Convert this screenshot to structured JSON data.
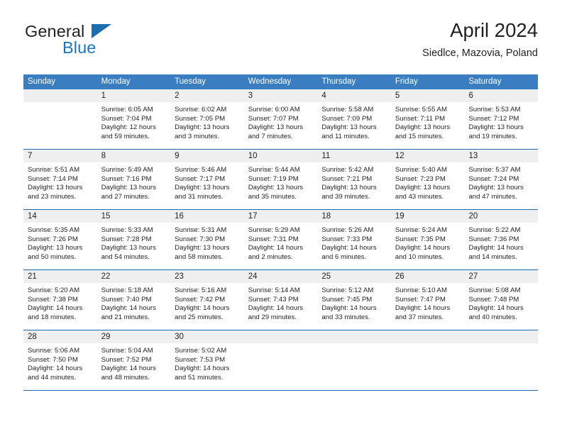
{
  "brand": {
    "name_top": "General",
    "name_bottom": "Blue",
    "triangle_color": "#1b6cb0",
    "blue_color": "#1b75bb"
  },
  "header": {
    "title": "April 2024",
    "subtitle": "Siedlce, Mazovia, Poland"
  },
  "colors": {
    "header_row": "#3a7dc0",
    "week_divider": "#1b6cb0",
    "daynum_band": "#efefef",
    "text": "#231f20"
  },
  "weekdays": [
    "Sunday",
    "Monday",
    "Tuesday",
    "Wednesday",
    "Thursday",
    "Friday",
    "Saturday"
  ],
  "weeks": [
    [
      {
        "day": "",
        "lines": []
      },
      {
        "day": "1",
        "lines": [
          "Sunrise: 6:05 AM",
          "Sunset: 7:04 PM",
          "Daylight: 12 hours",
          "and 59 minutes."
        ]
      },
      {
        "day": "2",
        "lines": [
          "Sunrise: 6:02 AM",
          "Sunset: 7:05 PM",
          "Daylight: 13 hours",
          "and 3 minutes."
        ]
      },
      {
        "day": "3",
        "lines": [
          "Sunrise: 6:00 AM",
          "Sunset: 7:07 PM",
          "Daylight: 13 hours",
          "and 7 minutes."
        ]
      },
      {
        "day": "4",
        "lines": [
          "Sunrise: 5:58 AM",
          "Sunset: 7:09 PM",
          "Daylight: 13 hours",
          "and 11 minutes."
        ]
      },
      {
        "day": "5",
        "lines": [
          "Sunrise: 5:55 AM",
          "Sunset: 7:11 PM",
          "Daylight: 13 hours",
          "and 15 minutes."
        ]
      },
      {
        "day": "6",
        "lines": [
          "Sunrise: 5:53 AM",
          "Sunset: 7:12 PM",
          "Daylight: 13 hours",
          "and 19 minutes."
        ]
      }
    ],
    [
      {
        "day": "7",
        "lines": [
          "Sunrise: 5:51 AM",
          "Sunset: 7:14 PM",
          "Daylight: 13 hours",
          "and 23 minutes."
        ]
      },
      {
        "day": "8",
        "lines": [
          "Sunrise: 5:49 AM",
          "Sunset: 7:16 PM",
          "Daylight: 13 hours",
          "and 27 minutes."
        ]
      },
      {
        "day": "9",
        "lines": [
          "Sunrise: 5:46 AM",
          "Sunset: 7:17 PM",
          "Daylight: 13 hours",
          "and 31 minutes."
        ]
      },
      {
        "day": "10",
        "lines": [
          "Sunrise: 5:44 AM",
          "Sunset: 7:19 PM",
          "Daylight: 13 hours",
          "and 35 minutes."
        ]
      },
      {
        "day": "11",
        "lines": [
          "Sunrise: 5:42 AM",
          "Sunset: 7:21 PM",
          "Daylight: 13 hours",
          "and 39 minutes."
        ]
      },
      {
        "day": "12",
        "lines": [
          "Sunrise: 5:40 AM",
          "Sunset: 7:23 PM",
          "Daylight: 13 hours",
          "and 43 minutes."
        ]
      },
      {
        "day": "13",
        "lines": [
          "Sunrise: 5:37 AM",
          "Sunset: 7:24 PM",
          "Daylight: 13 hours",
          "and 47 minutes."
        ]
      }
    ],
    [
      {
        "day": "14",
        "lines": [
          "Sunrise: 5:35 AM",
          "Sunset: 7:26 PM",
          "Daylight: 13 hours",
          "and 50 minutes."
        ]
      },
      {
        "day": "15",
        "lines": [
          "Sunrise: 5:33 AM",
          "Sunset: 7:28 PM",
          "Daylight: 13 hours",
          "and 54 minutes."
        ]
      },
      {
        "day": "16",
        "lines": [
          "Sunrise: 5:31 AM",
          "Sunset: 7:30 PM",
          "Daylight: 13 hours",
          "and 58 minutes."
        ]
      },
      {
        "day": "17",
        "lines": [
          "Sunrise: 5:29 AM",
          "Sunset: 7:31 PM",
          "Daylight: 14 hours",
          "and 2 minutes."
        ]
      },
      {
        "day": "18",
        "lines": [
          "Sunrise: 5:26 AM",
          "Sunset: 7:33 PM",
          "Daylight: 14 hours",
          "and 6 minutes."
        ]
      },
      {
        "day": "19",
        "lines": [
          "Sunrise: 5:24 AM",
          "Sunset: 7:35 PM",
          "Daylight: 14 hours",
          "and 10 minutes."
        ]
      },
      {
        "day": "20",
        "lines": [
          "Sunrise: 5:22 AM",
          "Sunset: 7:36 PM",
          "Daylight: 14 hours",
          "and 14 minutes."
        ]
      }
    ],
    [
      {
        "day": "21",
        "lines": [
          "Sunrise: 5:20 AM",
          "Sunset: 7:38 PM",
          "Daylight: 14 hours",
          "and 18 minutes."
        ]
      },
      {
        "day": "22",
        "lines": [
          "Sunrise: 5:18 AM",
          "Sunset: 7:40 PM",
          "Daylight: 14 hours",
          "and 21 minutes."
        ]
      },
      {
        "day": "23",
        "lines": [
          "Sunrise: 5:16 AM",
          "Sunset: 7:42 PM",
          "Daylight: 14 hours",
          "and 25 minutes."
        ]
      },
      {
        "day": "24",
        "lines": [
          "Sunrise: 5:14 AM",
          "Sunset: 7:43 PM",
          "Daylight: 14 hours",
          "and 29 minutes."
        ]
      },
      {
        "day": "25",
        "lines": [
          "Sunrise: 5:12 AM",
          "Sunset: 7:45 PM",
          "Daylight: 14 hours",
          "and 33 minutes."
        ]
      },
      {
        "day": "26",
        "lines": [
          "Sunrise: 5:10 AM",
          "Sunset: 7:47 PM",
          "Daylight: 14 hours",
          "and 37 minutes."
        ]
      },
      {
        "day": "27",
        "lines": [
          "Sunrise: 5:08 AM",
          "Sunset: 7:48 PM",
          "Daylight: 14 hours",
          "and 40 minutes."
        ]
      }
    ],
    [
      {
        "day": "28",
        "lines": [
          "Sunrise: 5:06 AM",
          "Sunset: 7:50 PM",
          "Daylight: 14 hours",
          "and 44 minutes."
        ]
      },
      {
        "day": "29",
        "lines": [
          "Sunrise: 5:04 AM",
          "Sunset: 7:52 PM",
          "Daylight: 14 hours",
          "and 48 minutes."
        ]
      },
      {
        "day": "30",
        "lines": [
          "Sunrise: 5:02 AM",
          "Sunset: 7:53 PM",
          "Daylight: 14 hours",
          "and 51 minutes."
        ]
      },
      {
        "day": "",
        "lines": []
      },
      {
        "day": "",
        "lines": []
      },
      {
        "day": "",
        "lines": []
      },
      {
        "day": "",
        "lines": []
      }
    ]
  ]
}
